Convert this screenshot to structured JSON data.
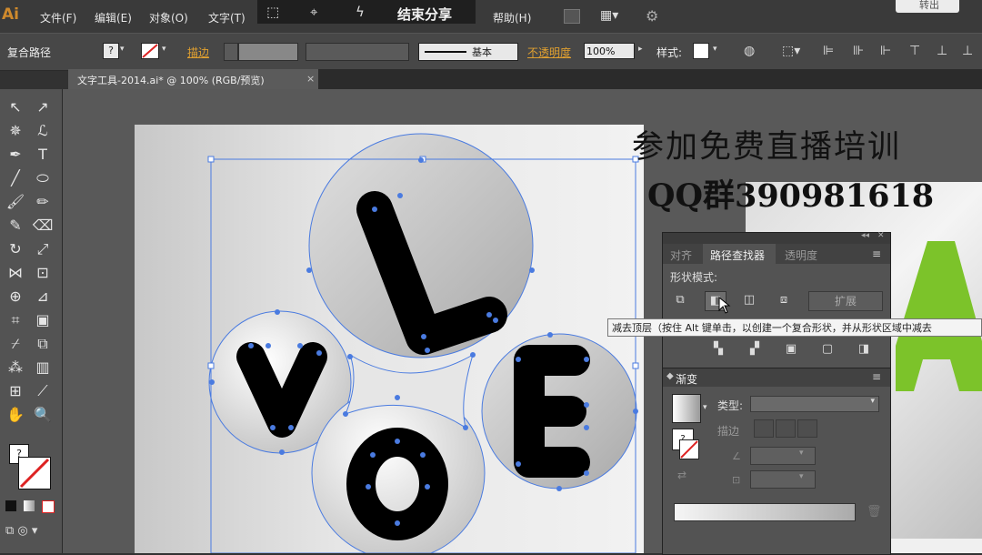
{
  "app": {
    "logo": "Ai"
  },
  "menu": {
    "items": [
      "文件(F)",
      "编辑(E)",
      "对象(O)",
      "文字(T)",
      "帮助(H)"
    ],
    "share_label": "结束分享",
    "top_right_button": "转出"
  },
  "control_bar": {
    "object_type": "复合路径",
    "stroke_label": "描边",
    "stroke_style": "基本",
    "opacity_label": "不透明度",
    "opacity_value": "100%",
    "style_label": "样式:"
  },
  "document": {
    "tab_title": "文字工具-2014.ai* @ 100% (RGB/预览)",
    "close": "×"
  },
  "artwork": {
    "letters": [
      "L",
      "V",
      "E",
      "O"
    ]
  },
  "watermark": {
    "line1": "参加免费直播培训",
    "line2": "QQ群390981618"
  },
  "pathfinder_panel": {
    "tabs": [
      "对齐",
      "路径查找器",
      "透明度"
    ],
    "active_tab": 1,
    "shape_modes_label": "形状模式:",
    "expand_label": "扩展",
    "menu_icon": "≡"
  },
  "tooltip": {
    "text": "减去顶层（按住 Alt 键单击，以创建一个复合形状，并从形状区域中减去"
  },
  "gradient_panel": {
    "title": "渐变",
    "type_label": "类型:",
    "stroke_label": "描边"
  },
  "colors": {
    "accent": "#e0a030",
    "selection": "#3a6fd8",
    "panel": "#535353"
  }
}
